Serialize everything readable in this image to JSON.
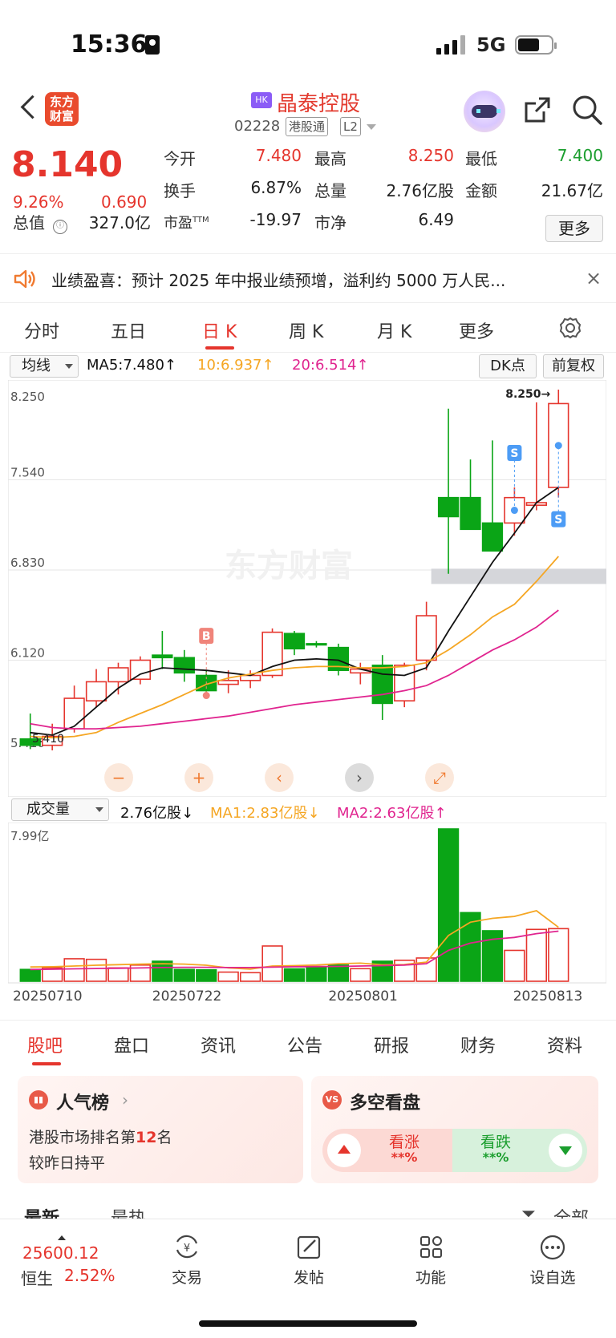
{
  "status_bar": {
    "time": "15:36",
    "network": "5G"
  },
  "header": {
    "logo_text": "东方财富",
    "market_badge": "HK",
    "stock_name": "晶泰控股",
    "stock_code": "02228",
    "tags": [
      "港股通",
      "L2"
    ]
  },
  "quote": {
    "price": "8.140",
    "change_pct": "9.26%",
    "change": "0.690",
    "fields": [
      {
        "label": "今开",
        "value": "7.480",
        "color": "red"
      },
      {
        "label": "最高",
        "value": "8.250",
        "color": "red"
      },
      {
        "label": "最低",
        "value": "7.400",
        "color": "green"
      },
      {
        "label": "换手",
        "value": "6.87%",
        "color": "dark"
      },
      {
        "label": "总量",
        "value": "2.76亿股",
        "color": "dark"
      },
      {
        "label": "金额",
        "value": "21.67亿",
        "color": "dark"
      },
      {
        "label": "总值",
        "value": "327.0亿",
        "color": "dark"
      },
      {
        "label": "市盈",
        "label_sup": "TTM",
        "value": "-19.97",
        "color": "dark"
      },
      {
        "label": "市净",
        "value": "6.49",
        "color": "dark"
      }
    ],
    "info_icon": "ⓘ",
    "more_label": "更多"
  },
  "notice": {
    "text": "业绩盈喜：预计 2025 年中报业绩预增，溢利约 5000 万人民...",
    "close": "×"
  },
  "chart_tabs": {
    "items": [
      "分时",
      "五日",
      "日 K",
      "周 K",
      "月 K",
      "更多"
    ],
    "active": 2
  },
  "ma_bar": {
    "selector": "均线",
    "ma5": "MA5:7.480↑",
    "ma10": "10:6.937↑",
    "ma20": "20:6.514↑",
    "dk_button": "DK点",
    "adjust_button": "前复权"
  },
  "controls": {
    "minus": "−",
    "plus": "+",
    "prev": "‹",
    "next": "›",
    "fullscreen": "⤢"
  },
  "colors": {
    "up": "#e5352d",
    "down": "#0aa516",
    "ma5": "#111111",
    "ma10": "#f5a623",
    "ma20": "#e0248f",
    "accent": "#e5352d"
  },
  "chart_data": [
    {
      "type": "candlestick",
      "title": "",
      "y_axis_labels": [
        "8.250",
        "7.540",
        "6.830",
        "6.120",
        "5.410"
      ],
      "ylim": [
        5.41,
        8.25
      ],
      "high_label": "8.250→",
      "low_label": "5.410",
      "watermark": "东方财富",
      "candles": [
        {
          "o": 5.5,
          "h": 5.7,
          "l": 5.42,
          "c": 5.45
        },
        {
          "o": 5.45,
          "h": 5.62,
          "l": 5.41,
          "c": 5.52
        },
        {
          "o": 5.58,
          "h": 5.92,
          "l": 5.55,
          "c": 5.82
        },
        {
          "o": 5.8,
          "h": 6.05,
          "l": 5.75,
          "c": 5.95
        },
        {
          "o": 5.95,
          "h": 6.1,
          "l": 5.85,
          "c": 6.06
        },
        {
          "o": 5.97,
          "h": 6.15,
          "l": 5.93,
          "c": 6.12
        },
        {
          "o": 6.16,
          "h": 6.35,
          "l": 6.05,
          "c": 6.14
        },
        {
          "o": 6.14,
          "h": 6.2,
          "l": 5.95,
          "c": 6.02
        },
        {
          "o": 6.0,
          "h": 6.04,
          "l": 5.84,
          "c": 5.88
        },
        {
          "o": 5.93,
          "h": 6.04,
          "l": 5.86,
          "c": 5.96
        },
        {
          "o": 5.96,
          "h": 6.04,
          "l": 5.9,
          "c": 6.0
        },
        {
          "o": 6.0,
          "h": 6.37,
          "l": 5.98,
          "c": 6.34
        },
        {
          "o": 6.33,
          "h": 6.35,
          "l": 6.16,
          "c": 6.21
        },
        {
          "o": 6.25,
          "h": 6.27,
          "l": 6.22,
          "c": 6.24
        },
        {
          "o": 6.22,
          "h": 6.25,
          "l": 6.0,
          "c": 6.04
        },
        {
          "o": 6.02,
          "h": 6.1,
          "l": 5.93,
          "c": 6.05
        },
        {
          "o": 6.08,
          "h": 6.16,
          "l": 5.65,
          "c": 5.78
        },
        {
          "o": 5.8,
          "h": 6.1,
          "l": 5.75,
          "c": 6.08
        },
        {
          "o": 6.12,
          "h": 6.58,
          "l": 6.04,
          "c": 6.47
        },
        {
          "o": 7.4,
          "h": 8.1,
          "l": 6.8,
          "c": 7.25
        },
        {
          "o": 7.4,
          "h": 7.7,
          "l": 7.21,
          "c": 7.15
        },
        {
          "o": 7.2,
          "h": 7.85,
          "l": 7.15,
          "c": 6.98
        },
        {
          "o": 7.2,
          "h": 7.48,
          "l": 7.1,
          "c": 7.4
        },
        {
          "o": 7.34,
          "h": 8.15,
          "l": 7.3,
          "c": 7.36
        },
        {
          "o": 7.48,
          "h": 8.25,
          "l": 7.4,
          "c": 8.14
        }
      ],
      "ma5": [
        5.55,
        5.53,
        5.6,
        5.75,
        5.9,
        6.01,
        6.06,
        6.05,
        6.04,
        6.02,
        6.0,
        6.07,
        6.12,
        6.13,
        6.12,
        6.05,
        6.01,
        6.0,
        6.06,
        6.35,
        6.62,
        6.89,
        7.12,
        7.36,
        7.48
      ],
      "ma10": [
        5.52,
        5.51,
        5.52,
        5.55,
        5.63,
        5.7,
        5.77,
        5.85,
        5.93,
        5.98,
        6.01,
        6.04,
        6.06,
        6.07,
        6.07,
        6.06,
        6.06,
        6.07,
        6.1,
        6.2,
        6.32,
        6.46,
        6.56,
        6.74,
        6.937
      ],
      "ma20": [
        5.62,
        5.59,
        5.58,
        5.58,
        5.59,
        5.6,
        5.62,
        5.64,
        5.66,
        5.68,
        5.71,
        5.74,
        5.77,
        5.79,
        5.81,
        5.83,
        5.85,
        5.88,
        5.92,
        6.0,
        6.1,
        6.2,
        6.28,
        6.38,
        6.514
      ],
      "markers": [
        {
          "index": 8,
          "label": "B",
          "position": "above"
        },
        {
          "index": 22,
          "label": "S",
          "position": "above"
        },
        {
          "index": 24,
          "label": "S",
          "position": "below"
        }
      ],
      "shaded_band": [
        6.72,
        6.84
      ]
    },
    {
      "type": "bar",
      "title": "",
      "y_axis_labels": [
        "7.99亿"
      ],
      "ylim": [
        0,
        7.99
      ],
      "unit": "亿股",
      "x_labels": [
        "20250710",
        "20250722",
        "20250801",
        "20250813"
      ],
      "volumes": [
        0.62,
        0.7,
        1.18,
        1.15,
        0.7,
        0.85,
        1.05,
        0.62,
        0.6,
        0.48,
        0.45,
        1.85,
        0.65,
        0.72,
        0.85,
        0.66,
        1.05,
        1.1,
        1.22,
        7.99,
        3.6,
        2.65,
        1.62,
        2.72,
        2.76
      ],
      "ma1": [
        0.75,
        0.76,
        0.8,
        0.84,
        0.87,
        0.9,
        0.92,
        0.9,
        0.84,
        0.7,
        0.64,
        0.8,
        0.82,
        0.85,
        0.92,
        0.95,
        0.86,
        0.88,
        1.0,
        2.4,
        3.1,
        3.3,
        3.4,
        3.7,
        2.83
      ],
      "ma2": [
        0.62,
        0.63,
        0.65,
        0.67,
        0.68,
        0.7,
        0.72,
        0.73,
        0.73,
        0.72,
        0.72,
        0.74,
        0.76,
        0.77,
        0.78,
        0.8,
        0.82,
        0.85,
        0.92,
        1.62,
        2.0,
        2.2,
        2.3,
        2.5,
        2.63
      ]
    }
  ],
  "volume_bar": {
    "selector": "成交量",
    "value": "2.76亿股↓",
    "ma1": "MA1:2.83亿股↓",
    "ma2": "MA2:2.63亿股↑"
  },
  "bottom_tabs": {
    "items": [
      "股吧",
      "盘口",
      "资讯",
      "公告",
      "研报",
      "财务",
      "资料"
    ],
    "active": 0
  },
  "popularity_card": {
    "title": "人气榜",
    "rank_prefix": "港股市场排名第",
    "rank": "12",
    "rank_suffix": "名",
    "compare": "较昨日持平"
  },
  "sentiment_card": {
    "title": "多空看盘",
    "bull_label": "看涨",
    "bull_value": "**%",
    "bear_label": "看跌",
    "bear_value": "**%"
  },
  "sub_tabs": {
    "items": [
      "最新",
      "最热",
      "全部"
    ]
  },
  "bottom_nav": {
    "index_value": "25600.12",
    "index_name": "恒生",
    "index_pct": "2.52%",
    "items": [
      "交易",
      "发帖",
      "功能",
      "设自选"
    ]
  }
}
